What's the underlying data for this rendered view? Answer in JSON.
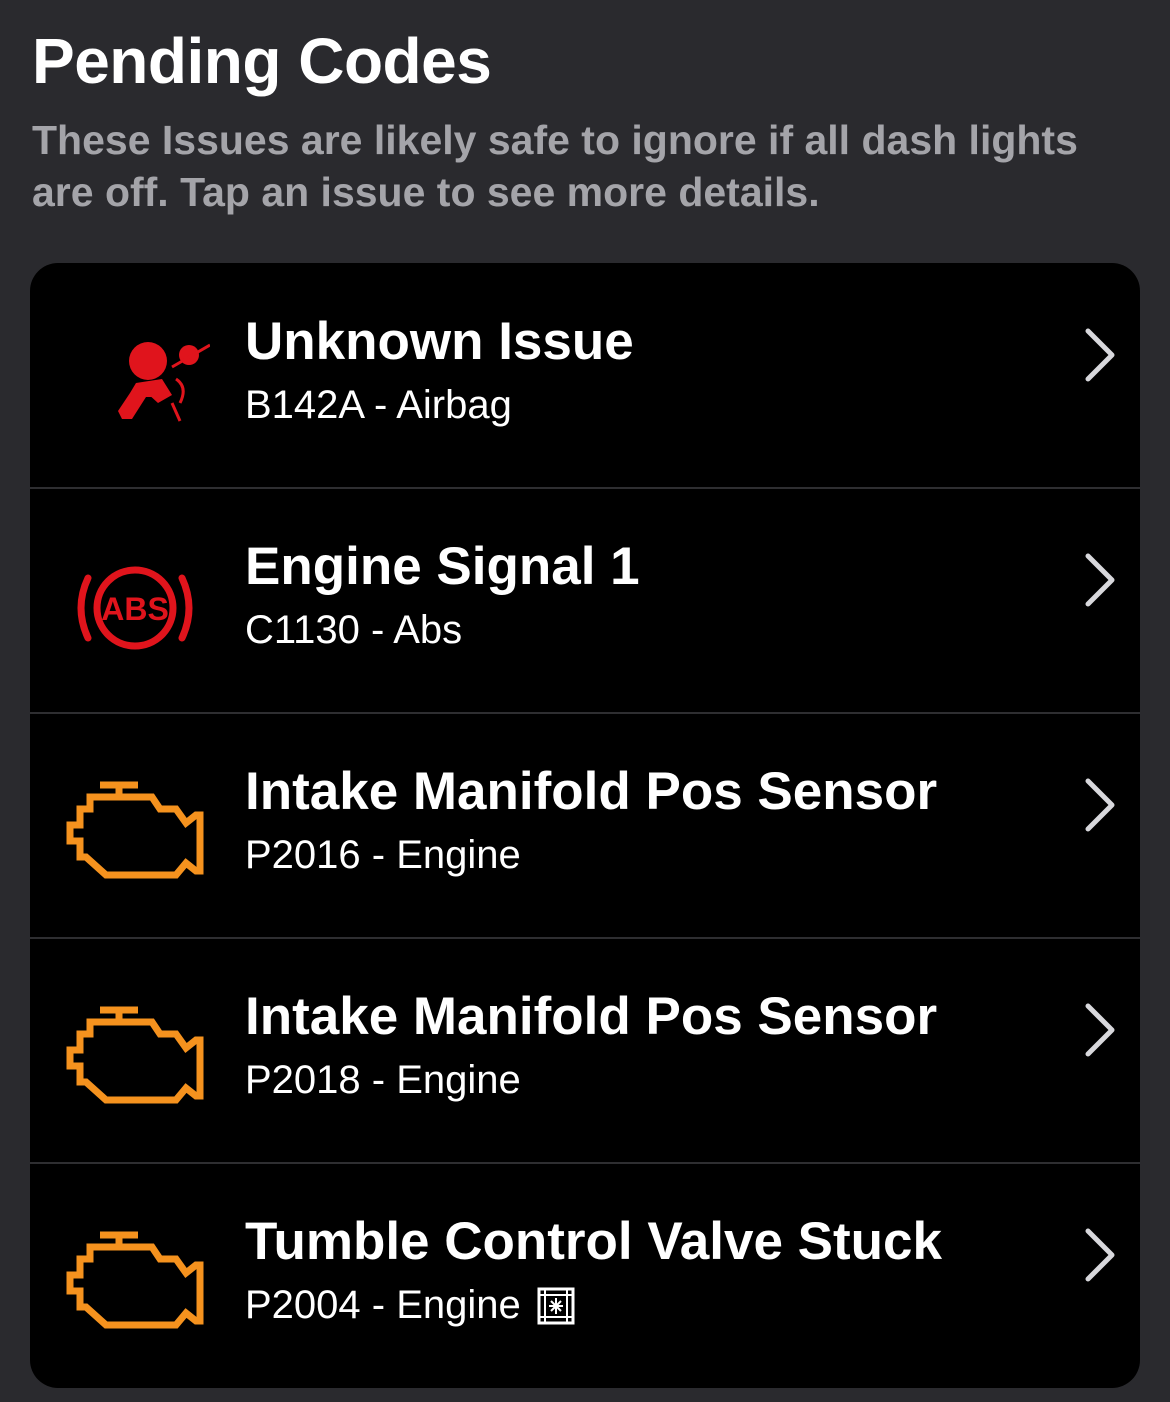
{
  "header": {
    "title": "Pending Codes",
    "subtitle": "These Issues are likely safe to ignore if all dash lights are off. Tap an issue to see more details."
  },
  "colors": {
    "background": "#2a2a2e",
    "card": "#000000",
    "subtitle_text": "#a4a4a9",
    "airbag_red": "#e0141c",
    "abs_red": "#e0141c",
    "engine_orange": "#f5921e"
  },
  "issues": [
    {
      "title": "Unknown Issue",
      "code": "B142A - Airbag",
      "icon": "airbag-icon"
    },
    {
      "title": "Engine Signal 1",
      "code": "C1130 - Abs",
      "icon": "abs-icon"
    },
    {
      "title": "Intake Manifold Pos Sensor",
      "code": "P2016 - Engine",
      "icon": "check-engine-icon"
    },
    {
      "title": "Intake Manifold Pos Sensor",
      "code": "P2018 - Engine",
      "icon": "check-engine-icon"
    },
    {
      "title": "Tumble Control Valve Stuck",
      "code": "P2004 - Engine",
      "icon": "check-engine-icon",
      "badge": "freeze-frame-icon"
    }
  ]
}
